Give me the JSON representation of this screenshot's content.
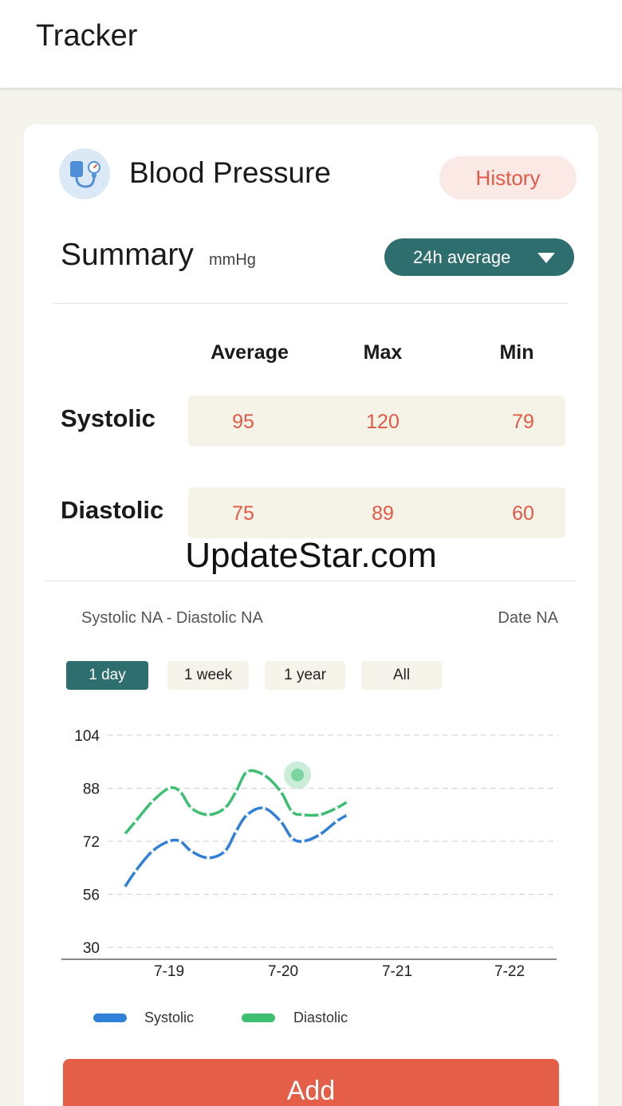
{
  "header": {
    "title": "Tracker"
  },
  "card": {
    "title": "Blood Pressure",
    "history_label": "History",
    "icon": "blood-pressure-monitor-icon"
  },
  "summary": {
    "title": "Summary",
    "unit": "mmHg",
    "period_select": "24h average",
    "columns": [
      "Average",
      "Max",
      "Min"
    ],
    "rows": [
      {
        "label": "Systolic",
        "values": [
          "95",
          "120",
          "79"
        ]
      },
      {
        "label": "Diastolic",
        "values": [
          "75",
          "89",
          "60"
        ]
      }
    ]
  },
  "watermark": "UpdateStar.com",
  "chart_info": {
    "selected_values": "Systolic NA - Diastolic NA",
    "selected_date": "Date NA"
  },
  "range_tabs": [
    {
      "label": "1 day",
      "active": true
    },
    {
      "label": "1 week",
      "active": false
    },
    {
      "label": "1 year",
      "active": false
    },
    {
      "label": "All",
      "active": false
    }
  ],
  "chart_data": {
    "type": "line",
    "y_ticks": [
      "104",
      "88",
      "72",
      "56",
      "30"
    ],
    "categories": [
      "7-19",
      "7-20",
      "7-21",
      "7-22"
    ],
    "x": [
      6.8,
      7.0,
      7.3,
      7.6,
      7.8,
      8.0,
      8.3,
      8.6,
      8.8,
      9.0,
      9.3,
      9.6,
      9.8,
      10.0,
      10.3,
      10.6,
      10.8
    ],
    "series": [
      {
        "name": "Systolic",
        "color": "#2f80d6",
        "values": [
          58,
          63,
          69,
          72,
          72,
          69,
          67,
          69,
          75,
          80,
          82,
          78,
          73,
          72,
          74,
          78,
          80
        ]
      },
      {
        "name": "Diastolic",
        "color": "#3dbf72",
        "values": [
          74,
          78,
          84,
          88,
          87,
          82,
          80,
          82,
          87,
          93,
          92,
          87,
          81,
          80,
          80,
          82,
          84
        ]
      }
    ],
    "highlight": {
      "series": "Diastolic",
      "x": 9.9,
      "y": 92
    },
    "grid": true,
    "legend": "bottom"
  },
  "add_button": "Add",
  "colors": {
    "accent": "#2e6e6e",
    "value": "#e25a45",
    "add": "#e55e47",
    "systolic": "#2f80d6",
    "diastolic": "#3dbf72"
  }
}
